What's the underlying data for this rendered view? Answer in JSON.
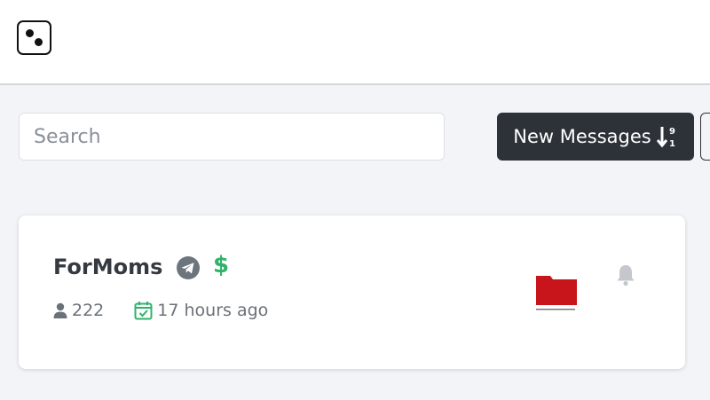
{
  "header": {
    "logo_icon": "dice-logo-icon"
  },
  "toolbar": {
    "search_placeholder": "Search",
    "sort_button_label": "New Messages",
    "sort_icon": "sort-numeric-desc-icon"
  },
  "channels": [
    {
      "name": "ForMoms",
      "platform_icon": "telegram-icon",
      "paid_icon": "dollar-icon",
      "subscribers": "222",
      "last_post": "17 hours ago",
      "thumbnail_icon": "red-folder-thumbnail",
      "notify_icon": "bell-icon"
    }
  ],
  "colors": {
    "header_bg": "#ffffff",
    "page_bg": "#f3f4f8",
    "dark_button": "#2d3238",
    "accent_green": "#2fb36a",
    "telegram_gray": "#6c757d",
    "thumbnail_red": "#c8151b"
  }
}
